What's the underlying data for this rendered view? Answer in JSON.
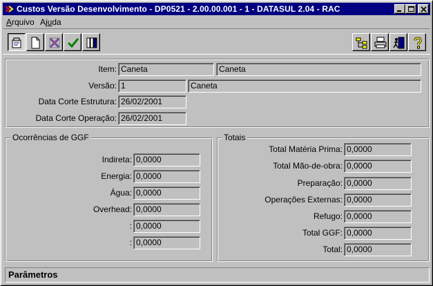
{
  "window": {
    "title": "Custos Versão Desenvolvimento - DP0521 - 2.00.00.001 - 1 - DATASUL 2.04 - RAC"
  },
  "menu": [
    {
      "pre": "",
      "ul": "A",
      "post": "rquivo"
    },
    {
      "pre": "Aj",
      "ul": "u",
      "post": "da"
    }
  ],
  "toolbar": {
    "left": [
      "properties-icon",
      "new-document-icon",
      "delete-icon",
      "check-icon",
      "columns-icon"
    ],
    "right": [
      "tree-icon",
      "printer-icon",
      "exit-icon",
      "help-icon"
    ]
  },
  "header": {
    "item_label": "Item:",
    "item_code": "Caneta",
    "item_desc": "Caneta",
    "versao_label": "Versão:",
    "versao_code": "1",
    "versao_desc": "Caneta",
    "corte_estrutura_label": "Data Corte Estrutura:",
    "corte_estrutura": "26/02/2001",
    "corte_operacao_label": "Data Corte Operação:",
    "corte_operacao": "26/02/2001"
  },
  "ggf": {
    "title": "Ocorrências de GGF",
    "rows": [
      {
        "label": "Indireta:",
        "value": "0,0000"
      },
      {
        "label": "Energia:",
        "value": "0,0000"
      },
      {
        "label": "Água:",
        "value": "0,0000"
      },
      {
        "label": "Overhead:",
        "value": "0,0000"
      },
      {
        "label": ":",
        "value": "0,0000"
      },
      {
        "label": ":",
        "value": "0,0000"
      }
    ]
  },
  "totais": {
    "title": "Totais",
    "rows": [
      {
        "label": "Total Matéria Prima:",
        "value": "0,0000"
      },
      {
        "label": "Total Mão-de-obra:",
        "value": "0,0000"
      },
      {
        "label": "Preparação:",
        "value": "0,0000"
      },
      {
        "label": "Operações Externas:",
        "value": "0,0000"
      },
      {
        "label": "Refugo:",
        "value": "0,0000"
      },
      {
        "label": "Total GGF:",
        "value": "0,0000"
      },
      {
        "label": "Total:",
        "value": "0,0000"
      }
    ]
  },
  "status": {
    "text": "Parâmetros"
  }
}
